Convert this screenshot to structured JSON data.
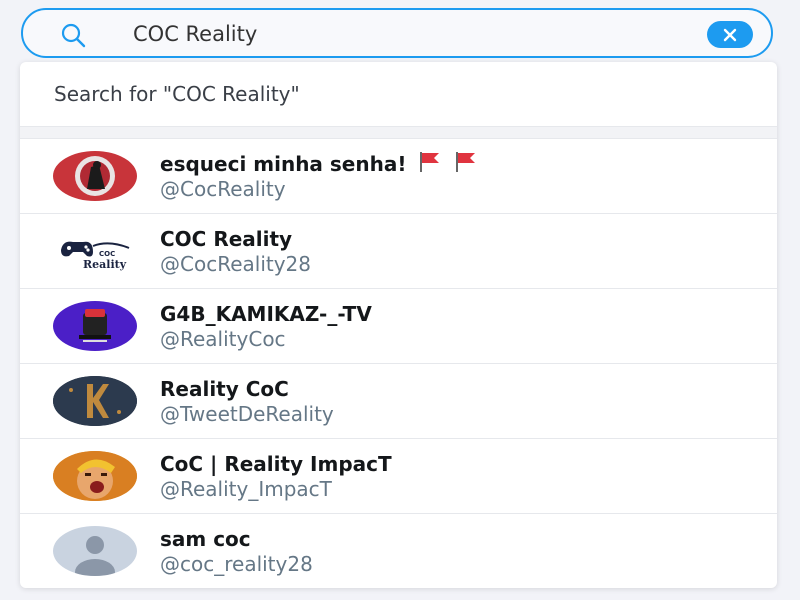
{
  "search": {
    "query": "COC Reality",
    "search_icon": "search-icon",
    "clear_icon": "close-icon",
    "accent_color": "#1d9bf0"
  },
  "dropdown": {
    "search_for_label": "Search for \"COC Reality\"",
    "results": [
      {
        "name": "esqueci minha senha!",
        "handle": "@CocReality",
        "badges": [
          "red-flag-icon",
          "red-flag-icon"
        ]
      },
      {
        "name": "COC Reality",
        "handle": "@CocReality28"
      },
      {
        "name": "G4B_KAMIKAZ-_-TV",
        "handle": "@RealityCoc"
      },
      {
        "name": "Reality CoC",
        "handle": "@TweetDeReality"
      },
      {
        "name": "CoC | Reality ImpacT",
        "handle": "@Reality_ImpacT"
      },
      {
        "name": "sam coc",
        "handle": "@coc_reality28"
      }
    ]
  },
  "avatar_logo_texts": [
    "COC",
    "Reality"
  ]
}
